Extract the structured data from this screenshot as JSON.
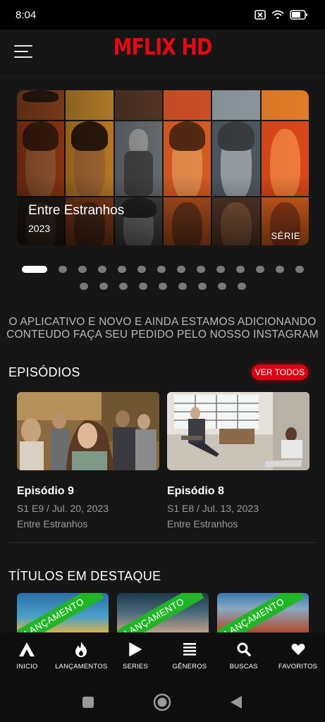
{
  "status_bar": {
    "time": "8:04",
    "icons": [
      "notification-x-icon",
      "wifi-icon",
      "battery-icon"
    ]
  },
  "app_bar": {
    "logo": "MFLIX HD",
    "menu_icon": "hamburger-menu-icon"
  },
  "hero": {
    "title": "Entre Estranhos",
    "year": "2023",
    "type": "SÉRIE",
    "slide_count": 23,
    "active_slide": 1
  },
  "notice": {
    "line1": "O APLICATIVO E NOVO E AINDA ESTAMOS ADICIONANDO",
    "line2": "CONTEUDO FAÇA SEU PEDIDO PELO NOSSO INSTAGRAM"
  },
  "episodes": {
    "section_title": "EPISÓDIOS",
    "see_all": "VER TODOS",
    "items": [
      {
        "title": "Episódio 9",
        "meta": "S1 E9 / Jul. 20, 2023",
        "show": "Entre Estranhos"
      },
      {
        "title": "Episódio 8",
        "meta": "S1 E8 / Jul. 13, 2023",
        "show": "Entre Estranhos"
      }
    ]
  },
  "featured": {
    "section_title": "TÍTULOS EM DESTAQUE",
    "ribbon_label": "LANÇAMENTO",
    "items": [
      {
        "ribbon": "LANÇAMENTO"
      },
      {
        "ribbon": "LANÇAMENTO"
      },
      {
        "ribbon": "LANÇAMENTO"
      }
    ]
  },
  "bottom_nav": {
    "items": [
      {
        "label": "INICIO",
        "icon": "home-a-icon"
      },
      {
        "label": "LANÇAMENTOS",
        "icon": "flame-icon"
      },
      {
        "label": "SERIES",
        "icon": "play-icon"
      },
      {
        "label": "GÊNEROS",
        "icon": "list-icon"
      },
      {
        "label": "BUSCAS",
        "icon": "search-icon"
      },
      {
        "label": "FAVORITOS",
        "icon": "heart-icon"
      }
    ]
  },
  "colors": {
    "background": "#161616",
    "brand_red": "#e50914",
    "ribbon_green": "#21b526",
    "muted_text": "#9a9a9a"
  }
}
